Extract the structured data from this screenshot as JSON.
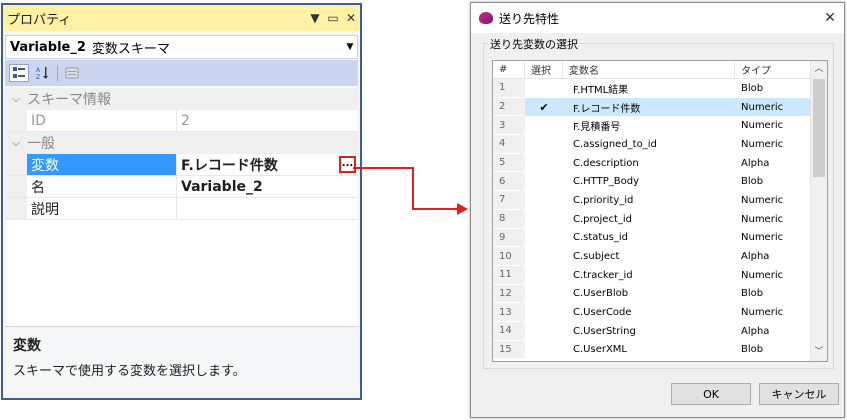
{
  "props": {
    "title": "プロパティ",
    "pin_icon": "▼",
    "restore_icon": "▭",
    "close_icon": "✕",
    "object_name": "Variable_2",
    "object_type": "変数スキーマ",
    "categories": [
      {
        "label": "スキーマ情報",
        "rows": [
          {
            "name": "ID",
            "value": "2",
            "gray": true
          }
        ]
      },
      {
        "label": "一般",
        "rows": [
          {
            "name": "変数",
            "value": "F.レコード件数",
            "selected": true,
            "bold": true
          },
          {
            "name": "名",
            "value": "Variable_2",
            "bold": true
          },
          {
            "name": "説明",
            "value": ""
          }
        ]
      }
    ],
    "ellipsis_label": "...",
    "description_title": "変数",
    "description_text": "スキーマで使用する変数を選択します。"
  },
  "dialog": {
    "title": "送り先特性",
    "group_label": "送り先変数の選択",
    "columns": [
      "#",
      "選択",
      "変数名",
      "タイプ"
    ],
    "rows": [
      {
        "num": "1",
        "checked": "",
        "name": "F.HTML結果",
        "type": "Blob"
      },
      {
        "num": "2",
        "checked": "✔",
        "name": "F.レコード件数",
        "type": "Numeric"
      },
      {
        "num": "3",
        "checked": "",
        "name": "F.見積番号",
        "type": "Numeric"
      },
      {
        "num": "4",
        "checked": "",
        "name": "C.assigned_to_id",
        "type": "Numeric"
      },
      {
        "num": "5",
        "checked": "",
        "name": "C.description",
        "type": "Alpha"
      },
      {
        "num": "6",
        "checked": "",
        "name": "C.HTTP_Body",
        "type": "Blob"
      },
      {
        "num": "7",
        "checked": "",
        "name": "C.priority_id",
        "type": "Numeric"
      },
      {
        "num": "8",
        "checked": "",
        "name": "C.project_id",
        "type": "Numeric"
      },
      {
        "num": "9",
        "checked": "",
        "name": "C.status_id",
        "type": "Numeric"
      },
      {
        "num": "10",
        "checked": "",
        "name": "C.subject",
        "type": "Alpha"
      },
      {
        "num": "11",
        "checked": "",
        "name": "C.tracker_id",
        "type": "Numeric"
      },
      {
        "num": "12",
        "checked": "",
        "name": "C.UserBlob",
        "type": "Blob"
      },
      {
        "num": "13",
        "checked": "",
        "name": "C.UserCode",
        "type": "Numeric"
      },
      {
        "num": "14",
        "checked": "",
        "name": "C.UserString",
        "type": "Alpha"
      },
      {
        "num": "15",
        "checked": "",
        "name": "C.UserXML",
        "type": "Blob"
      }
    ],
    "ok_label": "OK",
    "cancel_label": "キャンセル",
    "close_icon": "✕"
  },
  "colors": {
    "title_bar": "#fff1a6",
    "selection": "#3399ff",
    "list_selection": "#cce8ff",
    "highlight_red": "#e0201c"
  }
}
